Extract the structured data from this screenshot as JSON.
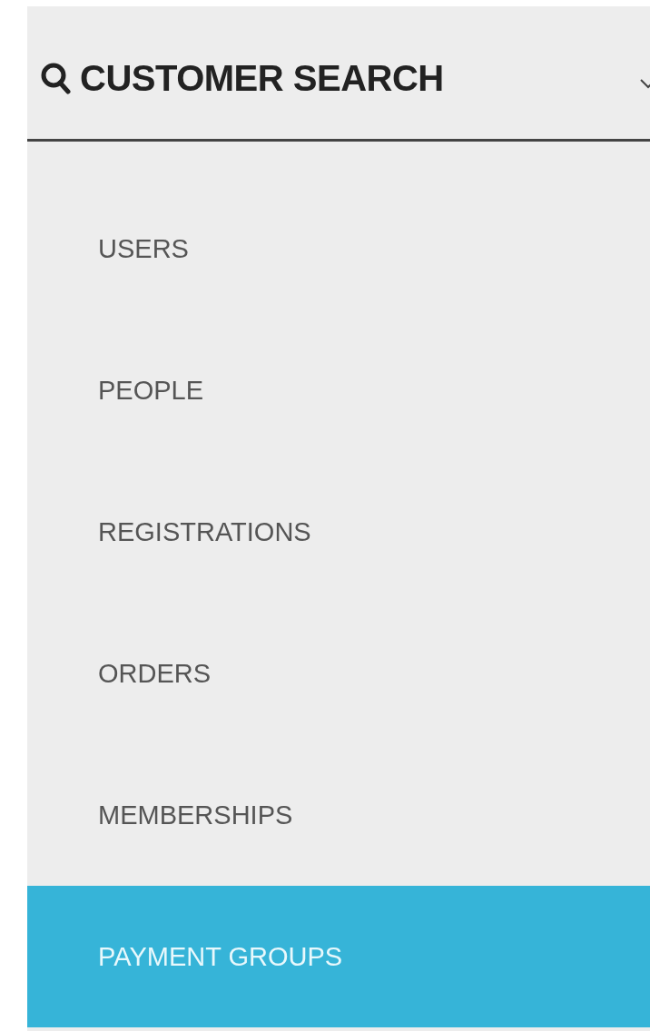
{
  "header": {
    "title": "CUSTOMER SEARCH",
    "expanded": true
  },
  "menu": [
    {
      "label": "USERS",
      "selected": false
    },
    {
      "label": "PEOPLE",
      "selected": false
    },
    {
      "label": "REGISTRATIONS",
      "selected": false
    },
    {
      "label": "ORDERS",
      "selected": false
    },
    {
      "label": "MEMBERSHIPS",
      "selected": false
    },
    {
      "label": "PAYMENT GROUPS",
      "selected": true
    }
  ]
}
